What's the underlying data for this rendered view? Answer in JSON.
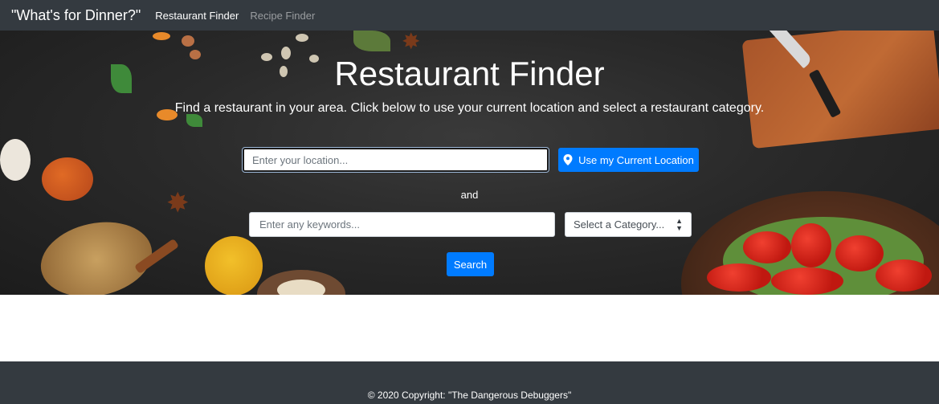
{
  "navbar": {
    "brand": "\"What's for Dinner?\"",
    "links": [
      {
        "label": "Restaurant Finder",
        "active": true
      },
      {
        "label": "Recipe Finder",
        "active": false
      }
    ]
  },
  "hero": {
    "title": "Restaurant Finder",
    "subtitle": "Find a restaurant in your area. Click below to use your current location and select a restaurant category.",
    "location_placeholder": "Enter your location...",
    "location_value": "",
    "location_button": "Use my Current Location",
    "location_button_icon": "map-pin-icon",
    "and_text": "and",
    "keywords_placeholder": "Enter any keywords...",
    "keywords_value": "",
    "category_selected": "Select a Category...",
    "search_button": "Search"
  },
  "footer": {
    "copyright": "© 2020 Copyright: \"The Dangerous Debuggers\""
  },
  "colors": {
    "navbar_bg": "#343a40",
    "primary": "#007bff",
    "footer_bg": "#343a40"
  }
}
